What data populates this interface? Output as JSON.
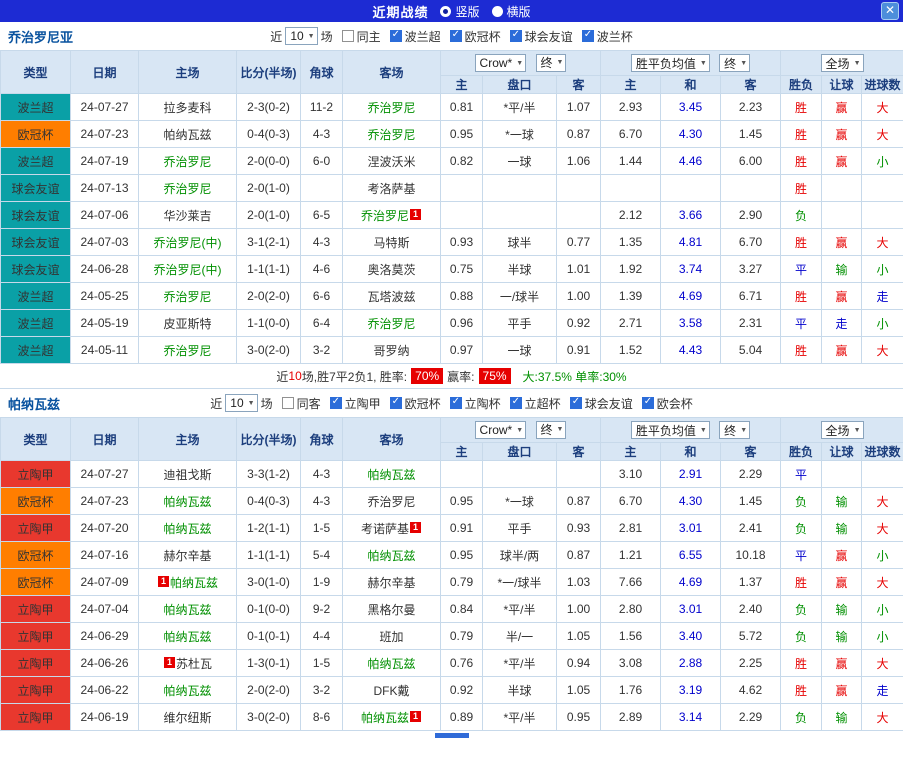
{
  "titlebar": {
    "title": "近期战绩",
    "vertical": "竖版",
    "horizontal": "横版",
    "close": "✕"
  },
  "league_colors": {
    "波兰超": "#0aa0a6",
    "欧冠杯": "#ff7e00",
    "球会友谊": "#0aa0a6",
    "立陶甲": "#e8382e"
  },
  "result_colors": {
    "胜": "red",
    "赢": "red",
    "大": "red",
    "负": "green",
    "输": "green",
    "小": "green",
    "平": "blue",
    "走": "blue"
  },
  "sections": [
    {
      "team": "乔治罗尼亚",
      "toolbar": {
        "near": "近",
        "games": "10",
        "unit": "场",
        "filters": [
          {
            "label": "同主",
            "checked": false
          },
          {
            "label": "波兰超",
            "checked": true
          },
          {
            "label": "欧冠杯",
            "checked": true
          },
          {
            "label": "球会友谊",
            "checked": true
          },
          {
            "label": "波兰杯",
            "checked": true
          }
        ]
      },
      "header": {
        "type": "类型",
        "date": "日期",
        "home": "主场",
        "score": "比分(半场)",
        "corner": "角球",
        "away": "客场",
        "provider": "Crow*",
        "time1": "终",
        "avg": "胜平负均值",
        "time2": "终",
        "period": "全场",
        "h_home": "主",
        "h_line": "盘口",
        "h_away": "客",
        "a_home": "主",
        "a_draw": "和",
        "a_away": "客",
        "r_outcome": "胜负",
        "r_handicap": "让球",
        "r_goals": "进球数"
      },
      "rows": [
        {
          "league": "波兰超",
          "date": "24-07-27",
          "home": {
            "name": "拉多麦科"
          },
          "score": "2-3(0-2)",
          "corner": "11-2",
          "away": {
            "name": "乔治罗尼",
            "focus": true
          },
          "odds_home": "0.81",
          "handicap": "*平/半",
          "odds_away": "1.07",
          "avg_home": "2.93",
          "avg_draw": "3.45",
          "avg_away": "2.23",
          "result": "胜",
          "handicap_result": "赢",
          "goals_result": "大"
        },
        {
          "league": "欧冠杯",
          "date": "24-07-23",
          "home": {
            "name": "帕纳瓦兹"
          },
          "score": "0-4(0-3)",
          "corner": "4-3",
          "away": {
            "name": "乔治罗尼",
            "focus": true
          },
          "odds_home": "0.95",
          "handicap": "*一球",
          "odds_away": "0.87",
          "avg_home": "6.70",
          "avg_draw": "4.30",
          "avg_away": "1.45",
          "result": "胜",
          "handicap_result": "赢",
          "goals_result": "大"
        },
        {
          "league": "波兰超",
          "date": "24-07-19",
          "home": {
            "name": "乔治罗尼",
            "focus": true
          },
          "score": "2-0(0-0)",
          "corner": "6-0",
          "away": {
            "name": "涅波沃米"
          },
          "odds_home": "0.82",
          "handicap": "一球",
          "odds_away": "1.06",
          "avg_home": "1.44",
          "avg_draw": "4.46",
          "avg_away": "6.00",
          "result": "胜",
          "handicap_result": "赢",
          "goals_result": "小"
        },
        {
          "league": "球会友谊",
          "date": "24-07-13",
          "home": {
            "name": "乔治罗尼",
            "focus": true
          },
          "score": "2-0(1-0)",
          "corner": "",
          "away": {
            "name": "考洛萨基"
          },
          "odds_home": "",
          "handicap": "",
          "odds_away": "",
          "avg_home": "",
          "avg_draw": "",
          "avg_away": "",
          "result": "胜",
          "handicap_result": "",
          "goals_result": ""
        },
        {
          "league": "球会友谊",
          "date": "24-07-06",
          "home": {
            "name": "华沙莱吉"
          },
          "score": "2-0(1-0)",
          "corner": "6-5",
          "away": {
            "name": "乔治罗尼",
            "focus": true,
            "card_post": "1"
          },
          "odds_home": "",
          "handicap": "",
          "odds_away": "",
          "avg_home": "2.12",
          "avg_draw": "3.66",
          "avg_away": "2.90",
          "result": "负",
          "handicap_result": "",
          "goals_result": ""
        },
        {
          "league": "球会友谊",
          "date": "24-07-03",
          "home": {
            "name": "乔治罗尼(中)",
            "focus": true
          },
          "score": "3-1(2-1)",
          "corner": "4-3",
          "away": {
            "name": "马特斯"
          },
          "odds_home": "0.93",
          "handicap": "球半",
          "odds_away": "0.77",
          "avg_home": "1.35",
          "avg_draw": "4.81",
          "avg_away": "6.70",
          "result": "胜",
          "handicap_result": "赢",
          "goals_result": "大"
        },
        {
          "league": "球会友谊",
          "date": "24-06-28",
          "home": {
            "name": "乔治罗尼(中)",
            "focus": true
          },
          "score": "1-1(1-1)",
          "corner": "4-6",
          "away": {
            "name": "奥洛莫茨"
          },
          "odds_home": "0.75",
          "handicap": "半球",
          "odds_away": "1.01",
          "avg_home": "1.92",
          "avg_draw": "3.74",
          "avg_away": "3.27",
          "result": "平",
          "handicap_result": "输",
          "goals_result": "小"
        },
        {
          "league": "波兰超",
          "date": "24-05-25",
          "home": {
            "name": "乔治罗尼",
            "focus": true
          },
          "score": "2-0(2-0)",
          "corner": "6-6",
          "away": {
            "name": "瓦塔波兹"
          },
          "odds_home": "0.88",
          "handicap": "一/球半",
          "odds_away": "1.00",
          "avg_home": "1.39",
          "avg_draw": "4.69",
          "avg_away": "6.71",
          "result": "胜",
          "handicap_result": "赢",
          "goals_result": "走"
        },
        {
          "league": "波兰超",
          "date": "24-05-19",
          "home": {
            "name": "皮亚斯特"
          },
          "score": "1-1(0-0)",
          "corner": "6-4",
          "away": {
            "name": "乔治罗尼",
            "focus": true
          },
          "odds_home": "0.96",
          "handicap": "平手",
          "odds_away": "0.92",
          "avg_home": "2.71",
          "avg_draw": "3.58",
          "avg_away": "2.31",
          "result": "平",
          "handicap_result": "走",
          "goals_result": "小"
        },
        {
          "league": "波兰超",
          "date": "24-05-11",
          "home": {
            "name": "乔治罗尼",
            "focus": true
          },
          "score": "3-0(2-0)",
          "corner": "3-2",
          "away": {
            "name": "哥罗纳"
          },
          "odds_home": "0.97",
          "handicap": "一球",
          "odds_away": "0.91",
          "avg_home": "1.52",
          "avg_draw": "4.43",
          "avg_away": "5.04",
          "result": "胜",
          "handicap_result": "赢",
          "goals_result": "大"
        }
      ],
      "summary": {
        "near": "近",
        "games": "10",
        "stats": "场,胜7平2负1, 胜率:",
        "win_rate": "70%",
        "asia_label": "赢率:",
        "asia_rate": "75%",
        "tail": "大:37.5% 单率:30%"
      }
    },
    {
      "team": "帕纳瓦兹",
      "toolbar": {
        "near": "近",
        "games": "10",
        "unit": "场",
        "filters": [
          {
            "label": "同客",
            "checked": false
          },
          {
            "label": "立陶甲",
            "checked": true
          },
          {
            "label": "欧冠杯",
            "checked": true
          },
          {
            "label": "立陶杯",
            "checked": true
          },
          {
            "label": "立超杯",
            "checked": true
          },
          {
            "label": "球会友谊",
            "checked": true
          },
          {
            "label": "欧会杯",
            "checked": true
          }
        ]
      },
      "header": {
        "type": "类型",
        "date": "日期",
        "home": "主场",
        "score": "比分(半场)",
        "corner": "角球",
        "away": "客场",
        "provider": "Crow*",
        "time1": "终",
        "avg": "胜平负均值",
        "time2": "终",
        "period": "全场",
        "h_home": "主",
        "h_line": "盘口",
        "h_away": "客",
        "a_home": "主",
        "a_draw": "和",
        "a_away": "客",
        "r_outcome": "胜负",
        "r_handicap": "让球",
        "r_goals": "进球数"
      },
      "rows": [
        {
          "league": "立陶甲",
          "date": "24-07-27",
          "home": {
            "name": "迪祖戈斯"
          },
          "score": "3-3(1-2)",
          "corner": "4-3",
          "away": {
            "name": "帕纳瓦兹",
            "focus": true
          },
          "odds_home": "",
          "handicap": "",
          "odds_away": "",
          "avg_home": "3.10",
          "avg_draw": "2.91",
          "avg_away": "2.29",
          "result": "平",
          "handicap_result": "",
          "goals_result": ""
        },
        {
          "league": "欧冠杯",
          "date": "24-07-23",
          "home": {
            "name": "帕纳瓦兹",
            "focus": true
          },
          "score": "0-4(0-3)",
          "corner": "4-3",
          "away": {
            "name": "乔治罗尼"
          },
          "odds_home": "0.95",
          "handicap": "*一球",
          "odds_away": "0.87",
          "avg_home": "6.70",
          "avg_draw": "4.30",
          "avg_away": "1.45",
          "result": "负",
          "handicap_result": "输",
          "goals_result": "大"
        },
        {
          "league": "立陶甲",
          "date": "24-07-20",
          "home": {
            "name": "帕纳瓦兹",
            "focus": true
          },
          "score": "1-2(1-1)",
          "corner": "1-5",
          "away": {
            "name": "考诺萨基",
            "card_post": "1"
          },
          "odds_home": "0.91",
          "handicap": "平手",
          "odds_away": "0.93",
          "avg_home": "2.81",
          "avg_draw": "3.01",
          "avg_away": "2.41",
          "result": "负",
          "handicap_result": "输",
          "goals_result": "大"
        },
        {
          "league": "欧冠杯",
          "date": "24-07-16",
          "home": {
            "name": "赫尔辛基"
          },
          "score": "1-1(1-1)",
          "corner": "5-4",
          "away": {
            "name": "帕纳瓦兹",
            "focus": true
          },
          "odds_home": "0.95",
          "handicap": "球半/两",
          "odds_away": "0.87",
          "avg_home": "1.21",
          "avg_draw": "6.55",
          "avg_away": "10.18",
          "result": "平",
          "handicap_result": "赢",
          "goals_result": "小"
        },
        {
          "league": "欧冠杯",
          "date": "24-07-09",
          "home": {
            "name": "帕纳瓦兹",
            "focus": true,
            "card_pre": "1"
          },
          "score": "3-0(1-0)",
          "corner": "1-9",
          "away": {
            "name": "赫尔辛基"
          },
          "odds_home": "0.79",
          "handicap": "*一/球半",
          "odds_away": "1.03",
          "avg_home": "7.66",
          "avg_draw": "4.69",
          "avg_away": "1.37",
          "result": "胜",
          "handicap_result": "赢",
          "goals_result": "大"
        },
        {
          "league": "立陶甲",
          "date": "24-07-04",
          "home": {
            "name": "帕纳瓦兹",
            "focus": true
          },
          "score": "0-1(0-0)",
          "corner": "9-2",
          "away": {
            "name": "黑格尔曼"
          },
          "odds_home": "0.84",
          "handicap": "*平/半",
          "odds_away": "1.00",
          "avg_home": "2.80",
          "avg_draw": "3.01",
          "avg_away": "2.40",
          "result": "负",
          "handicap_result": "输",
          "goals_result": "小"
        },
        {
          "league": "立陶甲",
          "date": "24-06-29",
          "home": {
            "name": "帕纳瓦兹",
            "focus": true
          },
          "score": "0-1(0-1)",
          "corner": "4-4",
          "away": {
            "name": "班加"
          },
          "odds_home": "0.79",
          "handicap": "半/一",
          "odds_away": "1.05",
          "avg_home": "1.56",
          "avg_draw": "3.40",
          "avg_away": "5.72",
          "result": "负",
          "handicap_result": "输",
          "goals_result": "小"
        },
        {
          "league": "立陶甲",
          "date": "24-06-26",
          "home": {
            "name": "苏杜瓦",
            "card_pre": "1"
          },
          "score": "1-3(0-1)",
          "corner": "1-5",
          "away": {
            "name": "帕纳瓦兹",
            "focus": true
          },
          "odds_home": "0.76",
          "handicap": "*平/半",
          "odds_away": "0.94",
          "avg_home": "3.08",
          "avg_draw": "2.88",
          "avg_away": "2.25",
          "result": "胜",
          "handicap_result": "赢",
          "goals_result": "大"
        },
        {
          "league": "立陶甲",
          "date": "24-06-22",
          "home": {
            "name": "帕纳瓦兹",
            "focus": true
          },
          "score": "2-0(2-0)",
          "corner": "3-2",
          "away": {
            "name": "DFK戴"
          },
          "odds_home": "0.92",
          "handicap": "半球",
          "odds_away": "1.05",
          "avg_home": "1.76",
          "avg_draw": "3.19",
          "avg_away": "4.62",
          "result": "胜",
          "handicap_result": "赢",
          "goals_result": "走"
        },
        {
          "league": "立陶甲",
          "date": "24-06-19",
          "home": {
            "name": "维尔纽斯"
          },
          "score": "3-0(2-0)",
          "corner": "8-6",
          "away": {
            "name": "帕纳瓦兹",
            "focus": true,
            "card_post": "1"
          },
          "odds_home": "0.89",
          "handicap": "*平/半",
          "odds_away": "0.95",
          "avg_home": "2.89",
          "avg_draw": "3.14",
          "avg_away": "2.29",
          "result": "负",
          "handicap_result": "输",
          "goals_result": "大"
        }
      ]
    }
  ]
}
